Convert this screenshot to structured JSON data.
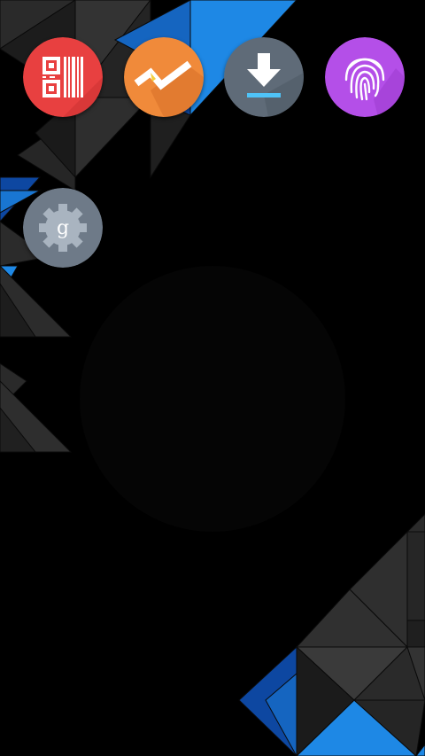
{
  "home_screen": {
    "apps": [
      {
        "name": "qr-barcode-scanner",
        "label": "",
        "icon": "qr-barcode-icon",
        "color": "#E84040"
      },
      {
        "name": "checklist",
        "label": "",
        "icon": "checkmark-chart-icon",
        "color": "#F08A3A"
      },
      {
        "name": "downloads",
        "label": "",
        "icon": "download-arrow-icon",
        "color": "#5F6B78"
      },
      {
        "name": "fingerprint",
        "label": "",
        "icon": "fingerprint-icon",
        "color": "#B44FE8"
      },
      {
        "name": "google-settings",
        "label": "",
        "icon": "google-gear-icon",
        "color": "#6E7A88"
      }
    ]
  },
  "wallpaper": {
    "style": "dark geometric triangles",
    "colors": {
      "dark": "#1E1E1E",
      "mid": "#2E2E2E",
      "blue": "#1976D2",
      "blue_dark": "#0D47A1"
    }
  }
}
